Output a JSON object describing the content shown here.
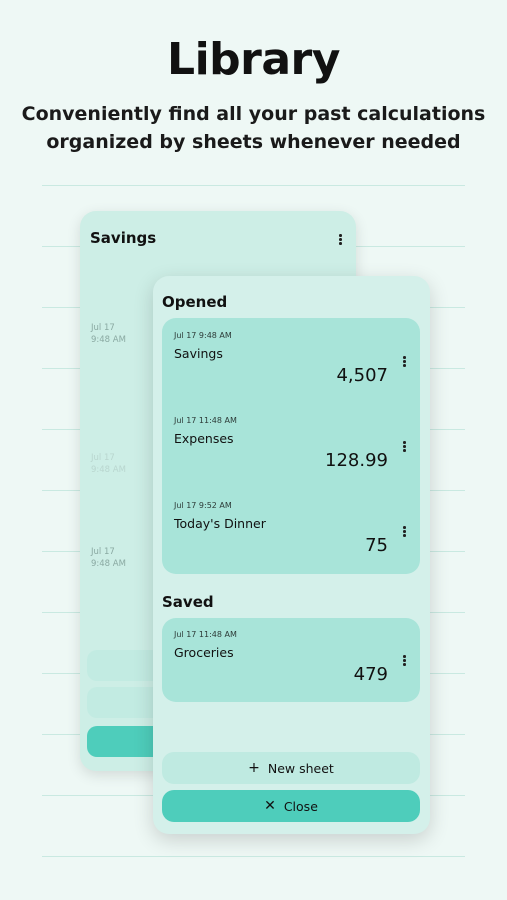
{
  "header": {
    "title": "Library",
    "subtitle_line1": "Conveniently find all your past calculations",
    "subtitle_line2": "organized by sheets whenever needed"
  },
  "back_sheet": {
    "title": "Savings",
    "menu_icon": "kebab-menu-icon",
    "entries": [
      {
        "date": "Jul 17",
        "time": "9:48 AM"
      },
      {
        "date": "Jul 17",
        "time": "9:48 AM"
      },
      {
        "date": "Jul 17",
        "time": "9:48 AM"
      }
    ]
  },
  "library": {
    "opened_label": "Opened",
    "saved_label": "Saved",
    "opened": [
      {
        "timestamp": "Jul 17 9:48 AM",
        "name": "Savings",
        "value": "4,507"
      },
      {
        "timestamp": "Jul 17 11:48 AM",
        "name": "Expenses",
        "value": "128.99"
      },
      {
        "timestamp": "Jul 17 9:52 AM",
        "name": "Today's Dinner",
        "value": "75"
      }
    ],
    "saved": [
      {
        "timestamp": "Jul 17 11:48 AM",
        "name": "Groceries",
        "value": "479"
      }
    ],
    "new_sheet_label": "New sheet",
    "new_sheet_icon": "plus-icon",
    "close_label": "Close",
    "close_icon": "close-icon"
  },
  "colors": {
    "background": "#eef8f5",
    "card": "#d4f0ea",
    "group": "#a8e4d9",
    "accent": "#4ecdbb"
  }
}
